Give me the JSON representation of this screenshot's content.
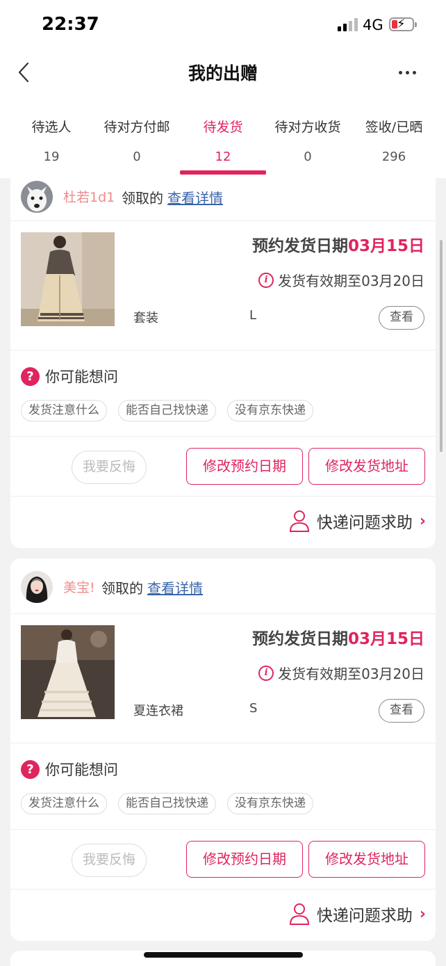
{
  "status_bar": {
    "time": "22:37",
    "network": "4G",
    "battery_color": "#e8323c"
  },
  "nav": {
    "title": "我的出赠"
  },
  "tabs": [
    {
      "label": "待选人",
      "count": "19"
    },
    {
      "label": "待对方付邮",
      "count": "0"
    },
    {
      "label": "待发货",
      "count": "12",
      "active": true
    },
    {
      "label": "待对方收货",
      "count": "0"
    },
    {
      "label": "签收/已晒",
      "count": "296"
    }
  ],
  "cards": [
    {
      "user": {
        "name": "杜若1d1",
        "claimed": "领取的",
        "details_link": "查看详情"
      },
      "product": {
        "ship_date_label": "预约发货日期",
        "ship_date": "03月15日",
        "valid_label": "发货有效期至03月20日",
        "type": "套装",
        "size": "L",
        "view_btn": "查看"
      },
      "faq": {
        "title": "你可能想问",
        "chips": [
          "发货注意什么",
          "能否自己找快递",
          "没有京东快递"
        ]
      },
      "actions": {
        "regret": "我要反悔",
        "change_date": "修改预约日期",
        "change_address": "修改发货地址"
      },
      "help": {
        "label": "快递问题求助"
      }
    },
    {
      "user": {
        "name": "美宝!",
        "claimed": "领取的",
        "details_link": "查看详情"
      },
      "product": {
        "ship_date_label": "预约发货日期",
        "ship_date": "03月15日",
        "valid_label": "发货有效期至03月20日",
        "type": "夏连衣裙",
        "size": "S",
        "view_btn": "查看"
      },
      "faq": {
        "title": "你可能想问",
        "chips": [
          "发货注意什么",
          "能否自己找快递",
          "没有京东快递"
        ]
      },
      "actions": {
        "regret": "我要反悔",
        "change_date": "修改预约日期",
        "change_address": "修改发货地址"
      },
      "help": {
        "label": "快递问题求助"
      }
    }
  ],
  "colors": {
    "accent": "#e0245e",
    "link": "#3a64a8",
    "username": "#f18a8a"
  }
}
